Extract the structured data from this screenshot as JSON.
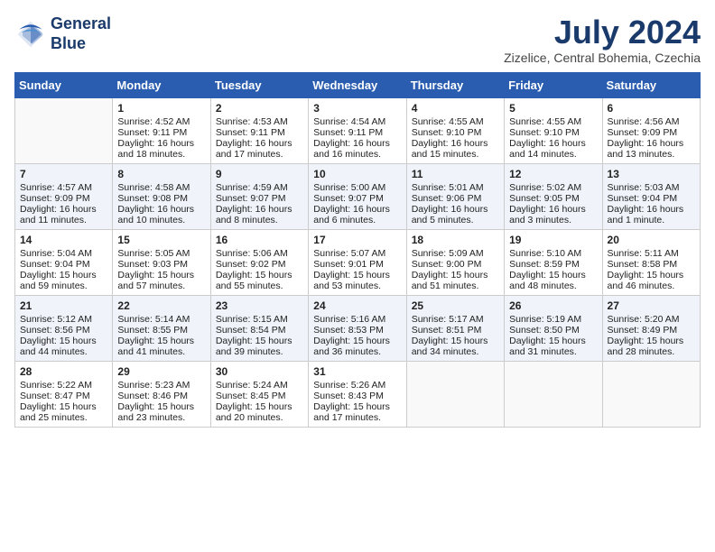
{
  "header": {
    "logo_line1": "General",
    "logo_line2": "Blue",
    "month_year": "July 2024",
    "location": "Zizelice, Central Bohemia, Czechia"
  },
  "days_of_week": [
    "Sunday",
    "Monday",
    "Tuesday",
    "Wednesday",
    "Thursday",
    "Friday",
    "Saturday"
  ],
  "weeks": [
    [
      {
        "day": "",
        "content": ""
      },
      {
        "day": "1",
        "content": "Sunrise: 4:52 AM\nSunset: 9:11 PM\nDaylight: 16 hours\nand 18 minutes."
      },
      {
        "day": "2",
        "content": "Sunrise: 4:53 AM\nSunset: 9:11 PM\nDaylight: 16 hours\nand 17 minutes."
      },
      {
        "day": "3",
        "content": "Sunrise: 4:54 AM\nSunset: 9:11 PM\nDaylight: 16 hours\nand 16 minutes."
      },
      {
        "day": "4",
        "content": "Sunrise: 4:55 AM\nSunset: 9:10 PM\nDaylight: 16 hours\nand 15 minutes."
      },
      {
        "day": "5",
        "content": "Sunrise: 4:55 AM\nSunset: 9:10 PM\nDaylight: 16 hours\nand 14 minutes."
      },
      {
        "day": "6",
        "content": "Sunrise: 4:56 AM\nSunset: 9:09 PM\nDaylight: 16 hours\nand 13 minutes."
      }
    ],
    [
      {
        "day": "7",
        "content": "Sunrise: 4:57 AM\nSunset: 9:09 PM\nDaylight: 16 hours\nand 11 minutes."
      },
      {
        "day": "8",
        "content": "Sunrise: 4:58 AM\nSunset: 9:08 PM\nDaylight: 16 hours\nand 10 minutes."
      },
      {
        "day": "9",
        "content": "Sunrise: 4:59 AM\nSunset: 9:07 PM\nDaylight: 16 hours\nand 8 minutes."
      },
      {
        "day": "10",
        "content": "Sunrise: 5:00 AM\nSunset: 9:07 PM\nDaylight: 16 hours\nand 6 minutes."
      },
      {
        "day": "11",
        "content": "Sunrise: 5:01 AM\nSunset: 9:06 PM\nDaylight: 16 hours\nand 5 minutes."
      },
      {
        "day": "12",
        "content": "Sunrise: 5:02 AM\nSunset: 9:05 PM\nDaylight: 16 hours\nand 3 minutes."
      },
      {
        "day": "13",
        "content": "Sunrise: 5:03 AM\nSunset: 9:04 PM\nDaylight: 16 hours\nand 1 minute."
      }
    ],
    [
      {
        "day": "14",
        "content": "Sunrise: 5:04 AM\nSunset: 9:04 PM\nDaylight: 15 hours\nand 59 minutes."
      },
      {
        "day": "15",
        "content": "Sunrise: 5:05 AM\nSunset: 9:03 PM\nDaylight: 15 hours\nand 57 minutes."
      },
      {
        "day": "16",
        "content": "Sunrise: 5:06 AM\nSunset: 9:02 PM\nDaylight: 15 hours\nand 55 minutes."
      },
      {
        "day": "17",
        "content": "Sunrise: 5:07 AM\nSunset: 9:01 PM\nDaylight: 15 hours\nand 53 minutes."
      },
      {
        "day": "18",
        "content": "Sunrise: 5:09 AM\nSunset: 9:00 PM\nDaylight: 15 hours\nand 51 minutes."
      },
      {
        "day": "19",
        "content": "Sunrise: 5:10 AM\nSunset: 8:59 PM\nDaylight: 15 hours\nand 48 minutes."
      },
      {
        "day": "20",
        "content": "Sunrise: 5:11 AM\nSunset: 8:58 PM\nDaylight: 15 hours\nand 46 minutes."
      }
    ],
    [
      {
        "day": "21",
        "content": "Sunrise: 5:12 AM\nSunset: 8:56 PM\nDaylight: 15 hours\nand 44 minutes."
      },
      {
        "day": "22",
        "content": "Sunrise: 5:14 AM\nSunset: 8:55 PM\nDaylight: 15 hours\nand 41 minutes."
      },
      {
        "day": "23",
        "content": "Sunrise: 5:15 AM\nSunset: 8:54 PM\nDaylight: 15 hours\nand 39 minutes."
      },
      {
        "day": "24",
        "content": "Sunrise: 5:16 AM\nSunset: 8:53 PM\nDaylight: 15 hours\nand 36 minutes."
      },
      {
        "day": "25",
        "content": "Sunrise: 5:17 AM\nSunset: 8:51 PM\nDaylight: 15 hours\nand 34 minutes."
      },
      {
        "day": "26",
        "content": "Sunrise: 5:19 AM\nSunset: 8:50 PM\nDaylight: 15 hours\nand 31 minutes."
      },
      {
        "day": "27",
        "content": "Sunrise: 5:20 AM\nSunset: 8:49 PM\nDaylight: 15 hours\nand 28 minutes."
      }
    ],
    [
      {
        "day": "28",
        "content": "Sunrise: 5:22 AM\nSunset: 8:47 PM\nDaylight: 15 hours\nand 25 minutes."
      },
      {
        "day": "29",
        "content": "Sunrise: 5:23 AM\nSunset: 8:46 PM\nDaylight: 15 hours\nand 23 minutes."
      },
      {
        "day": "30",
        "content": "Sunrise: 5:24 AM\nSunset: 8:45 PM\nDaylight: 15 hours\nand 20 minutes."
      },
      {
        "day": "31",
        "content": "Sunrise: 5:26 AM\nSunset: 8:43 PM\nDaylight: 15 hours\nand 17 minutes."
      },
      {
        "day": "",
        "content": ""
      },
      {
        "day": "",
        "content": ""
      },
      {
        "day": "",
        "content": ""
      }
    ]
  ]
}
